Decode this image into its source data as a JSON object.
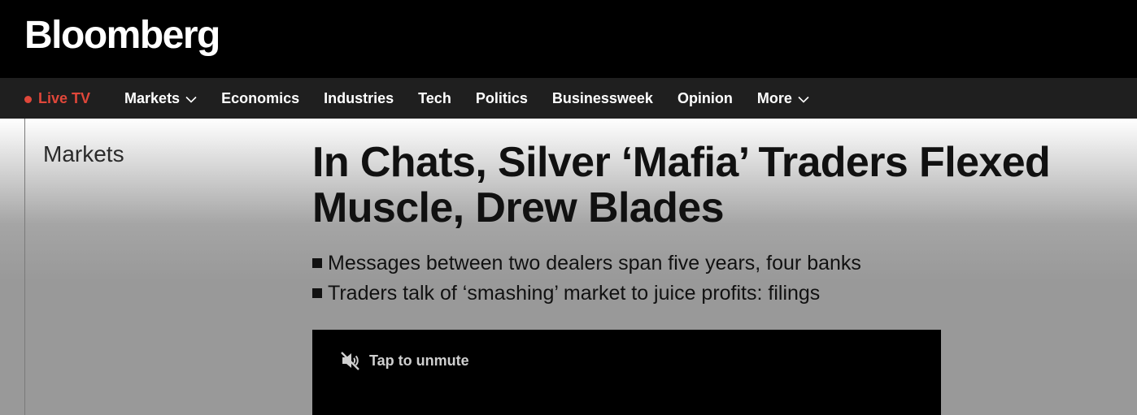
{
  "header": {
    "logo": "Bloomberg"
  },
  "nav": {
    "live_label": "Live TV",
    "items": [
      {
        "label": "Markets",
        "has_dropdown": true
      },
      {
        "label": "Economics",
        "has_dropdown": false
      },
      {
        "label": "Industries",
        "has_dropdown": false
      },
      {
        "label": "Tech",
        "has_dropdown": false
      },
      {
        "label": "Politics",
        "has_dropdown": false
      },
      {
        "label": "Businessweek",
        "has_dropdown": false
      },
      {
        "label": "Opinion",
        "has_dropdown": false
      },
      {
        "label": "More",
        "has_dropdown": true
      }
    ]
  },
  "article": {
    "section": "Markets",
    "headline": "In Chats, Silver ‘Mafia’ Traders Flexed Muscle, Drew Blades",
    "bullets": [
      "Messages between two dealers span five years, four banks",
      "Traders talk of ‘smashing’ market to juice profits: filings"
    ]
  },
  "video": {
    "unmute_label": "Tap to unmute",
    "icon": "muted-speaker-icon"
  },
  "colors": {
    "live_accent": "#e0473a",
    "nav_bg": "#1f1f1f",
    "header_bg": "#000000"
  }
}
